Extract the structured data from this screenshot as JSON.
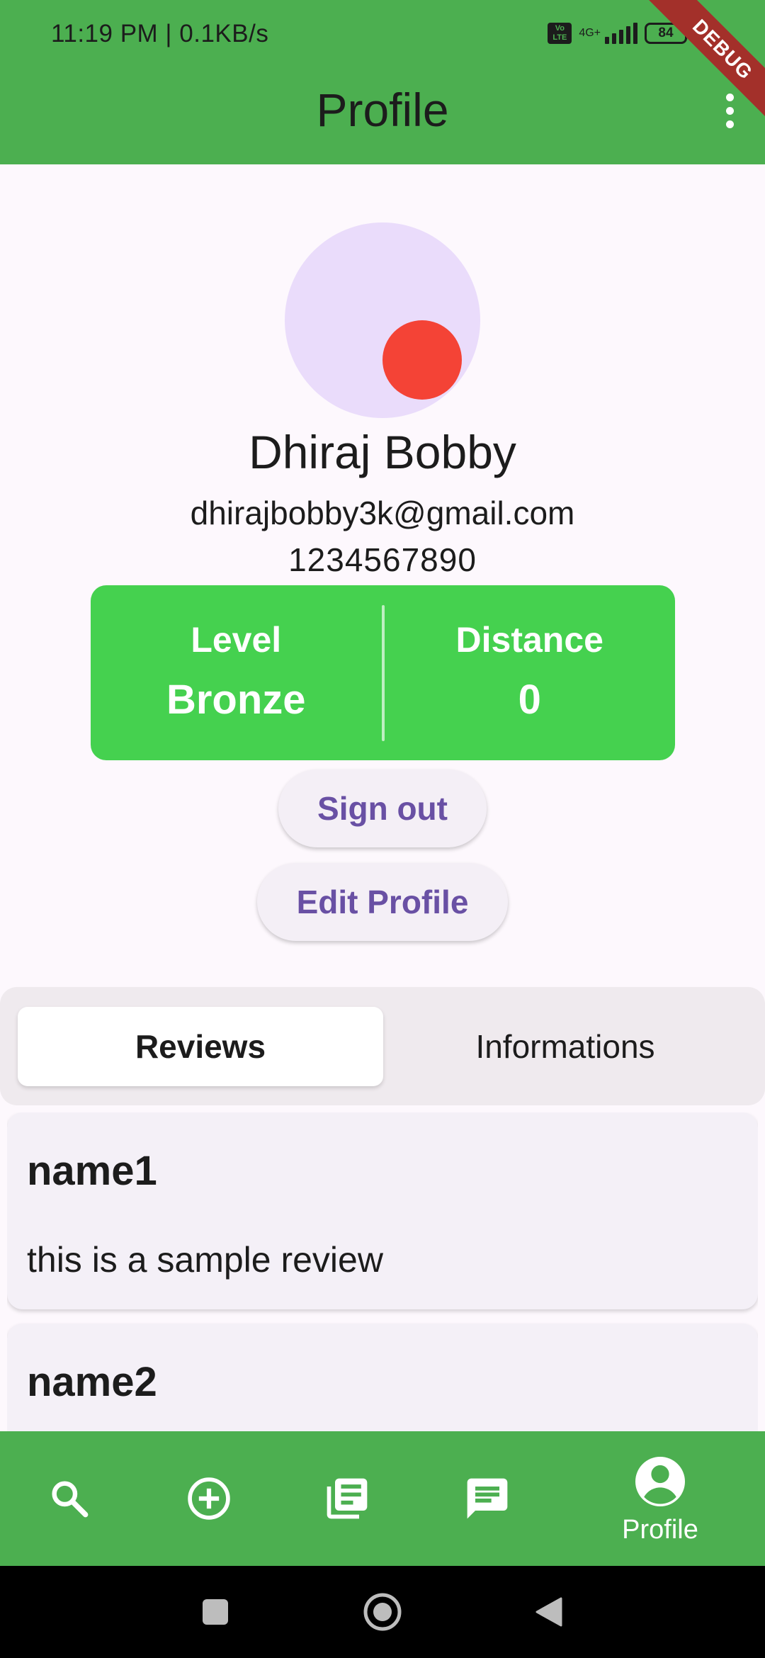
{
  "status_bar": {
    "time": "11:19 PM | 0.1KB/s",
    "network_type": "4G+",
    "volte_label": "Vo LTE",
    "battery": "84"
  },
  "debug_banner": "DEBUG",
  "app_bar": {
    "title": "Profile"
  },
  "profile": {
    "name": "Dhiraj Bobby",
    "email": "dhirajbobby3k@gmail.com",
    "phone": "1234567890",
    "stats": {
      "level_label": "Level",
      "level_value": "Bronze",
      "distance_label": "Distance",
      "distance_value": "0"
    }
  },
  "actions": {
    "sign_out_label": "Sign out",
    "edit_profile_label": "Edit Profile"
  },
  "tabs": [
    {
      "label": "Reviews",
      "active": true
    },
    {
      "label": "Informations",
      "active": false
    }
  ],
  "reviews": [
    {
      "name": "name1",
      "text": "this is a sample review"
    },
    {
      "name": "name2",
      "text": ""
    }
  ],
  "bottom_nav": {
    "items": [
      {
        "icon": "search-icon"
      },
      {
        "icon": "add-circle-icon"
      },
      {
        "icon": "library-books-icon"
      },
      {
        "icon": "chat-icon"
      },
      {
        "icon": "account-circle-icon",
        "label": "Profile",
        "active": true
      }
    ]
  },
  "colors": {
    "app_bar": "#4caf50",
    "stats_card": "#45d14f",
    "accent_text": "#6950a4",
    "avatar_bg": "#eadcfb",
    "avatar_dot": "#f44336"
  }
}
